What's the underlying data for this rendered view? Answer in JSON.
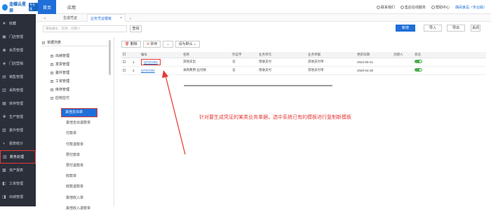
{
  "brand": {
    "name": "金蝶云星辰",
    "badge": "专业版"
  },
  "topnav": {
    "home": "首页",
    "app": "应用"
  },
  "topright": {
    "contact": "联系我们",
    "service": "售后在线服务",
    "help": "帮助中心",
    "user": "偶闹食品（专业版）"
  },
  "sidebar": {
    "items": [
      {
        "label": "收藏",
        "icon": "star-icon"
      },
      {
        "label": "门店管理",
        "icon": "store-icon"
      },
      {
        "label": "会员管理",
        "icon": "member-icon"
      },
      {
        "label": "门店营销",
        "icon": "marketing-icon"
      },
      {
        "label": "销售管理",
        "icon": "sales-icon"
      },
      {
        "label": "采购管理",
        "icon": "purchase-icon"
      },
      {
        "label": "库存管理",
        "icon": "inventory-icon"
      },
      {
        "label": "生产管理",
        "icon": "production-icon"
      },
      {
        "label": "委外管理",
        "icon": "outsource-icon"
      },
      {
        "label": "报表统计",
        "icon": "report-icon"
      },
      {
        "label": "账务处理",
        "icon": "accounting-icon"
      },
      {
        "label": "资产报表",
        "icon": "asset-icon"
      },
      {
        "label": "工资管理",
        "icon": "salary-icon"
      },
      {
        "label": "出纳管理",
        "icon": "cashier-icon"
      }
    ]
  },
  "tabs": {
    "t1": "生成凭证",
    "t2": "业务凭证模板"
  },
  "search": {
    "placeholder": "模板编号、名称、创建人",
    "button": "查询"
  },
  "toolbar": {
    "new": "新增",
    "import": "导入",
    "export": "导出",
    "close": "关闭"
  },
  "tree": {
    "root": "单据列表",
    "nodes": [
      "出纳管理",
      "发票管理",
      "委外管理",
      "工资管理",
      "库存管理",
      "应收应付"
    ],
    "leaves": [
      "其他支出单",
      "其他支出退款单",
      "付款单",
      "付款退款单",
      "预付款单",
      "预付退款单",
      "收款单",
      "收款退款单",
      "其他收入单",
      "其他收入退款单"
    ]
  },
  "actions": {
    "delete": "删除",
    "disable": "禁用",
    "set_default": "设为默认"
  },
  "table": {
    "headers": [
      "",
      "",
      "编号",
      "名称",
      "凭证字",
      "业务单元",
      "业务单据",
      "更新日期",
      "创建人",
      "状态"
    ],
    "rows": [
      {
        "idx": "1",
        "code": "QTZC001",
        "name": "其他支出",
        "voucher": "记",
        "unit": "借收支付",
        "doc": "其他支付单",
        "date": "2022-05-21",
        "creator": ""
      },
      {
        "idx": "2",
        "code": "QTZC002",
        "name": "采购费用-应付款",
        "voucher": "记",
        "unit": "借收支付",
        "doc": "其他支付单",
        "date": "2020-04-30",
        "creator": ""
      }
    ]
  },
  "annotation": "针对要生成凭证的某类业务单据，选中系统已有的模板进行复制新模板",
  "colors": {
    "accent": "#1e6fd9",
    "highlight": "#e53935",
    "sidebar": "#2b2f3a",
    "toggle": "#4caf50"
  }
}
